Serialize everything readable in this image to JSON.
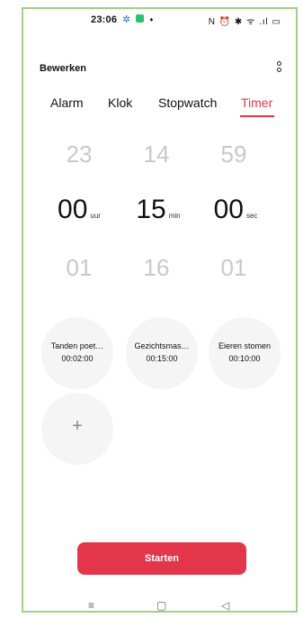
{
  "status": {
    "time": "23:06",
    "right_icons": "N ⏰ ✱ ᯤ .ıl ▭"
  },
  "topbar": {
    "edit": "Bewerken"
  },
  "tabs": [
    "Alarm",
    "Klok",
    "Stopwatch",
    "Timer"
  ],
  "picker": {
    "hours": {
      "above": "23",
      "value": "00",
      "below": "01",
      "unit": "uur"
    },
    "minutes": {
      "above": "14",
      "value": "15",
      "below": "16",
      "unit": "min"
    },
    "seconds": {
      "above": "59",
      "value": "00",
      "below": "01",
      "unit": "sec"
    }
  },
  "presets": [
    {
      "name": "Tanden poet…",
      "time": "00:02:00"
    },
    {
      "name": "Gezichtsmas…",
      "time": "00:15:00"
    },
    {
      "name": "Eieren stomen",
      "time": "00:10:00"
    }
  ],
  "add_label": "+",
  "start_label": "Starten",
  "nav": {
    "menu": "≡",
    "home": "▢",
    "back": "◁"
  },
  "colors": {
    "accent": "#e3364a",
    "frame": "#9fd184"
  }
}
